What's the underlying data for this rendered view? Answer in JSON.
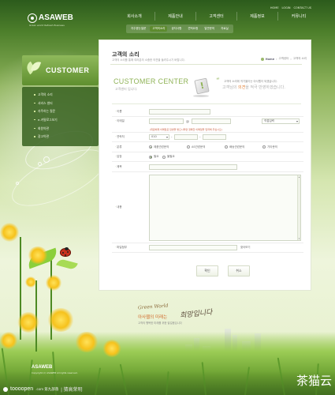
{
  "brand": {
    "name": "ASAWEB",
    "tagline": "Green world Refresh Business"
  },
  "util_nav": [
    "HOME",
    "LOGIN",
    "CONTACT US"
  ],
  "gnb": [
    "회사소개",
    "제품안내",
    "고객센터",
    "제품정보",
    "커뮤니티"
  ],
  "sub_nav": [
    "자주묻는질문",
    "고객의소리",
    "공지사항",
    "견적요청",
    "일반문의",
    "자료실"
  ],
  "side": {
    "title": "CUSTOMER",
    "menu": [
      "고객의 소리",
      "서비스 센터",
      "자주하는 질문",
      "e-카탈로그보기",
      "회원약관",
      "광고약관"
    ]
  },
  "content": {
    "title": "고객의 소리",
    "description": "고객의 소리를 통해 여러분의 소중한 의견을 들려주시기 바랍니다.",
    "breadcrumb": [
      "Home",
      "고객센터",
      "고객의 소리"
    ]
  },
  "banner": {
    "title": "CUSTOMER CENTER",
    "subtitle": "고객센터 입니다.",
    "message1": "고객의 소리에 귀기울이는 아사웹이 되겠습니다.",
    "message2_prefix": "고객님의 ",
    "message2_highlight": "의견",
    "message2_suffix": "을 적극 반영하겠습니다."
  },
  "form": {
    "labels": {
      "name": "이름",
      "email": "이메일",
      "phone": "연락처",
      "category": "분류",
      "reply": "답장",
      "subject": "제목",
      "body": "내용",
      "attachment": "파일첨부"
    },
    "email_domain_select": "직접입력",
    "email_note": "(회원에게 이메일로 답변을 받으시려면 정확한 이메일을 입력해 주십시오)",
    "phone_prefix_select": "010",
    "category_options": [
      {
        "label": "제품관련문의",
        "checked": true
      },
      {
        "label": "AS관련문의",
        "checked": false
      },
      {
        "label": "배송관련문의",
        "checked": false
      },
      {
        "label": "기타문의",
        "checked": false
      }
    ],
    "reply_options": [
      {
        "label": "필요",
        "checked": true
      },
      {
        "label": "불필요",
        "checked": false
      }
    ],
    "file_button": "찾아보기"
  },
  "buttons": {
    "submit": "확인",
    "cancel": "취소"
  },
  "slogan": {
    "line1": "Green World",
    "line2": "아사웹의 미래는",
    "line3": "고객의 행복한 미래를 위한 발걸음입니다",
    "hand": "희망입니다"
  },
  "footer": {
    "logo": "ASAWEB",
    "copyright": "Copyright (c) ASAWEB All rights reserved."
  },
  "watermark": {
    "left_main": "toooopen",
    "left_sub": ".com 第九部落",
    "left_extra": "| 猜高荣明",
    "right": "茶猫云"
  },
  "colors": {
    "accent_green": "#8fb356",
    "dark_green": "#365f1e",
    "highlight_orange": "#e07a2a"
  }
}
